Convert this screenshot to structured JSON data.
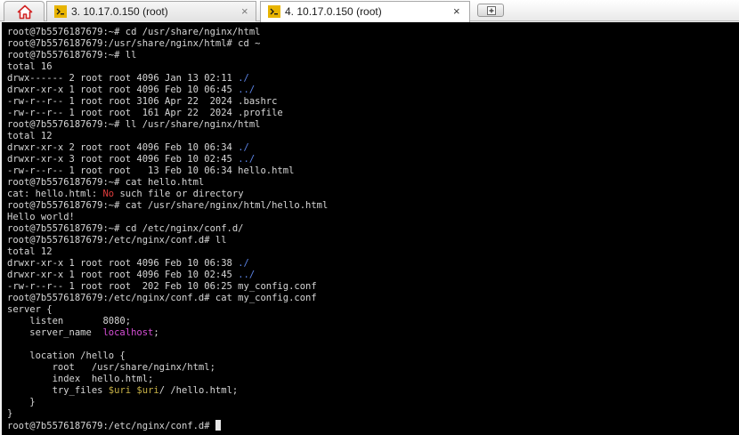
{
  "tabs": [
    {
      "label": "3. 10.17.0.150 (root)",
      "active": false
    },
    {
      "label": "4. 10.17.0.150 (root)",
      "active": true
    }
  ],
  "terminal": {
    "lines": [
      [
        {
          "t": "root@7b5576187679:~# cd /usr/share/nginx/html"
        }
      ],
      [
        {
          "t": "root@7b5576187679:/usr/share/nginx/html# cd ~"
        }
      ],
      [
        {
          "t": "root@7b5576187679:~# ll"
        }
      ],
      [
        {
          "t": "total 16"
        }
      ],
      [
        {
          "t": "drwx------ 2 root root 4096 Jan 13 02:11 "
        },
        {
          "t": "./",
          "c": "dir"
        }
      ],
      [
        {
          "t": "drwxr-xr-x 1 root root 4096 Feb 10 06:45 "
        },
        {
          "t": "../",
          "c": "dir"
        }
      ],
      [
        {
          "t": "-rw-r--r-- 1 root root 3106 Apr 22  2024 .bashrc"
        }
      ],
      [
        {
          "t": "-rw-r--r-- 1 root root  161 Apr 22  2024 .profile"
        }
      ],
      [
        {
          "t": "root@7b5576187679:~# ll /usr/share/nginx/html"
        }
      ],
      [
        {
          "t": "total 12"
        }
      ],
      [
        {
          "t": "drwxr-xr-x 2 root root 4096 Feb 10 06:34 "
        },
        {
          "t": "./",
          "c": "dir"
        }
      ],
      [
        {
          "t": "drwxr-xr-x 3 root root 4096 Feb 10 02:45 "
        },
        {
          "t": "../",
          "c": "dir"
        }
      ],
      [
        {
          "t": "-rw-r--r-- 1 root root   13 Feb 10 06:34 hello.html"
        }
      ],
      [
        {
          "t": "root@7b5576187679:~# cat hello.html"
        }
      ],
      [
        {
          "t": "cat: hello.html: "
        },
        {
          "t": "No",
          "c": "red"
        },
        {
          "t": " such file or directory"
        }
      ],
      [
        {
          "t": "root@7b5576187679:~# cat /usr/share/nginx/html/hello.html"
        }
      ],
      [
        {
          "t": "Hello world!"
        }
      ],
      [
        {
          "t": "root@7b5576187679:~# cd /etc/nginx/conf.d/"
        }
      ],
      [
        {
          "t": "root@7b5576187679:/etc/nginx/conf.d# ll"
        }
      ],
      [
        {
          "t": "total 12"
        }
      ],
      [
        {
          "t": "drwxr-xr-x 1 root root 4096 Feb 10 06:38 "
        },
        {
          "t": "./",
          "c": "dir"
        }
      ],
      [
        {
          "t": "drwxr-xr-x 1 root root 4096 Feb 10 02:45 "
        },
        {
          "t": "../",
          "c": "dir"
        }
      ],
      [
        {
          "t": "-rw-r--r-- 1 root root  202 Feb 10 06:25 my_config.conf"
        }
      ],
      [
        {
          "t": "root@7b5576187679:/etc/nginx/conf.d# cat my_config.conf"
        }
      ],
      [
        {
          "t": "server {"
        }
      ],
      [
        {
          "t": "    listen       8080;"
        }
      ],
      [
        {
          "t": "    server_name  "
        },
        {
          "t": "localhost",
          "c": "mag"
        },
        {
          "t": ";"
        }
      ],
      [
        {
          "t": ""
        }
      ],
      [
        {
          "t": "    location /hello {"
        }
      ],
      [
        {
          "t": "        root   /usr/share/nginx/html;"
        }
      ],
      [
        {
          "t": "        index  hello.html;"
        }
      ],
      [
        {
          "t": "        try_files "
        },
        {
          "t": "$uri",
          "c": "yel"
        },
        {
          "t": " "
        },
        {
          "t": "$uri",
          "c": "yel"
        },
        {
          "t": "/ /hello.html;"
        }
      ],
      [
        {
          "t": "    }"
        }
      ],
      [
        {
          "t": "}"
        }
      ],
      [
        {
          "t": "root@7b5576187679:/etc/nginx/conf.d# "
        },
        {
          "cursor": true
        }
      ]
    ]
  }
}
